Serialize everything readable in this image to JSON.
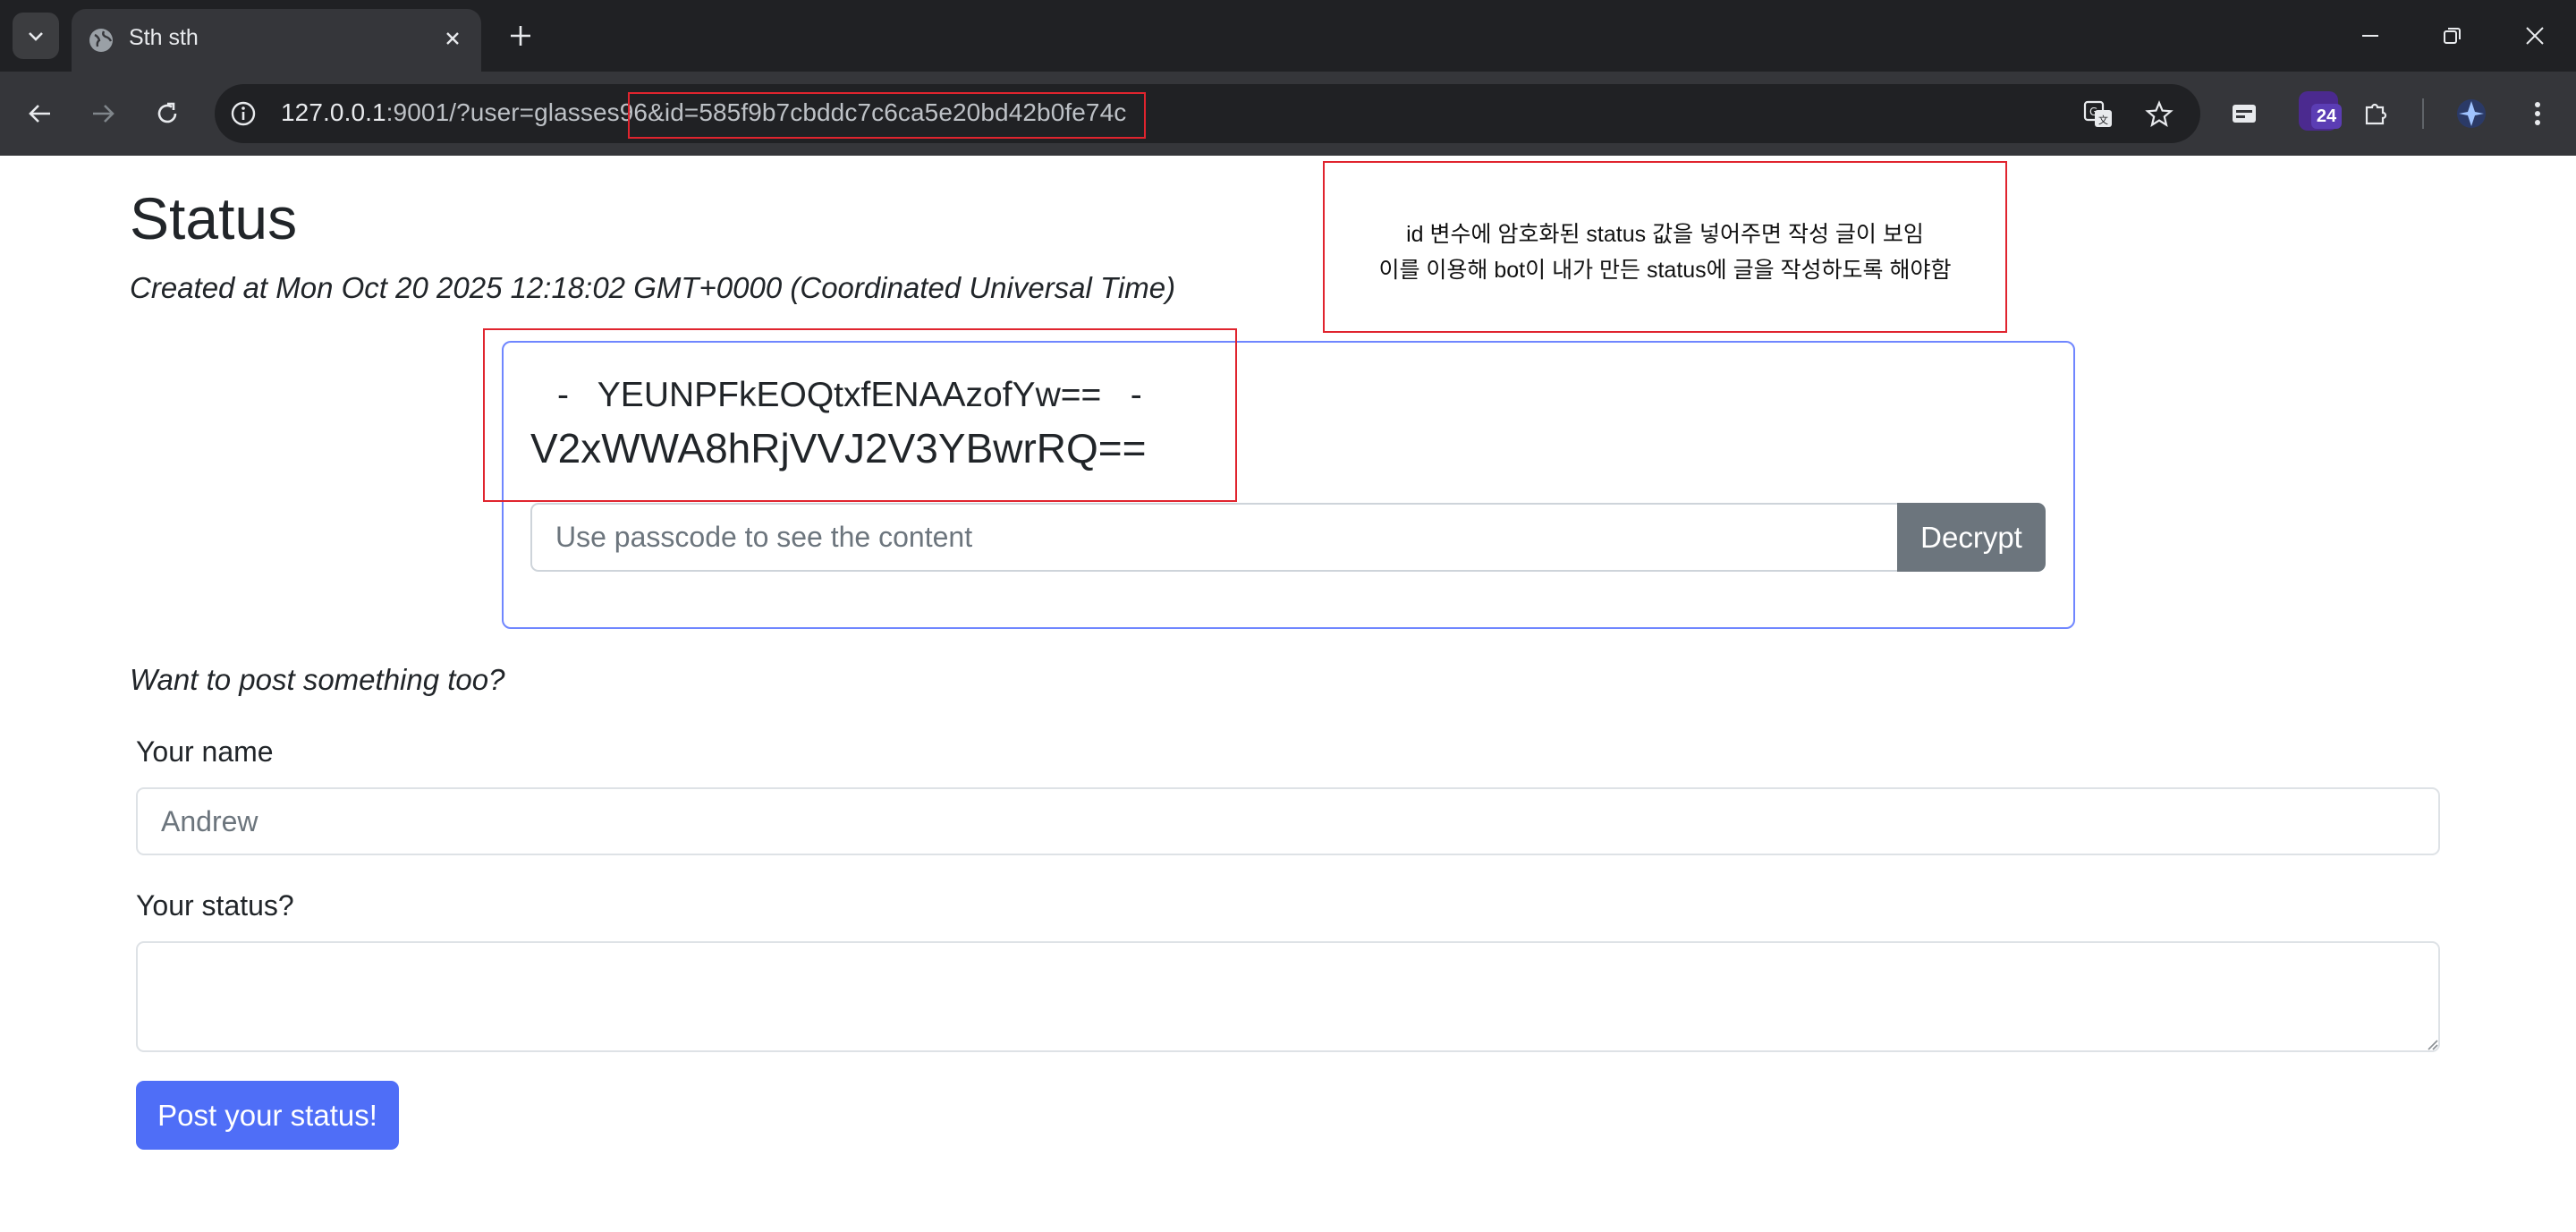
{
  "browser": {
    "tab_title": "Sth sth",
    "url_host": "127.0.0.1",
    "url_rest": ":9001/?user=glasses96&id=585f9b7cbddc7c6ca5e20bd42b0fe74c",
    "extension_badge": "24"
  },
  "page": {
    "title": "Status",
    "created": "Created at Mon Oct 20 2025 12:18:02 GMT+0000 (Coordinated Universal Time)"
  },
  "status_card": {
    "line1": "-   YEUNPFkEOQtxfENAAzofYw==   -",
    "line2": "V2xWWA8hRjVVJ2V3YBwrRQ==",
    "passcode_placeholder": "Use passcode to see the content",
    "decrypt_label": "Decrypt"
  },
  "post_form": {
    "prompt": "Want to post something too?",
    "name_label": "Your name",
    "name_placeholder": "Andrew",
    "status_label": "Your status?",
    "status_value": "",
    "submit_label": "Post your status!"
  },
  "annotation": {
    "line1": "id 변수에 암호화된 status 값을 넣어주면 작성 글이 보임",
    "line2": "이를 이용해 bot이 내가 만든 status에 글을 작성하도록 해야함"
  },
  "colors": {
    "annotation_red": "#e0242e",
    "card_border": "#6f86ff",
    "primary_button": "#4f6ef7",
    "secondary_button": "#6c757d"
  }
}
